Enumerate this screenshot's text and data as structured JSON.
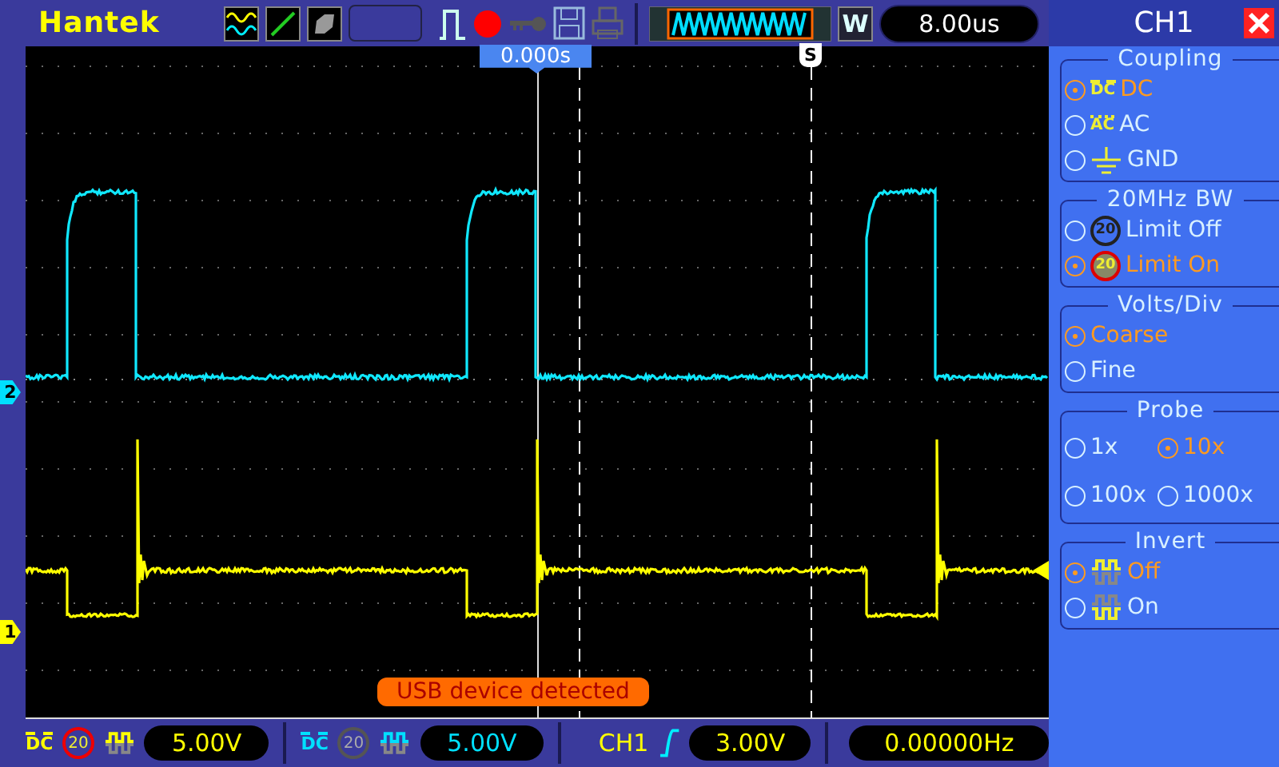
{
  "top_bar": {
    "logo": "Hantek",
    "timebase_mode": "W",
    "timebase": "8.00us"
  },
  "screen": {
    "time_position": "0.000s",
    "trigger_marker": "S",
    "message": "USB device detected",
    "markers": [
      {
        "label": "2",
        "color": "#00e0ff",
        "kind": "ch2"
      },
      {
        "label": "1",
        "color": "#ffff00",
        "kind": "ch1"
      }
    ]
  },
  "panel": {
    "title": "CH1",
    "groups": [
      {
        "title": "Coupling",
        "kind": "list",
        "options": [
          {
            "label": "DC",
            "kind": "dc",
            "icon_text": "DC",
            "selected": true
          },
          {
            "label": "AC",
            "kind": "ac",
            "icon_text": "AC",
            "selected": false
          },
          {
            "label": "GND",
            "kind": "gnd",
            "selected": false
          }
        ]
      },
      {
        "title": "20MHz BW",
        "kind": "list",
        "options": [
          {
            "label": "Limit Off",
            "kind": "bw_off",
            "icon_text": "20",
            "selected": false
          },
          {
            "label": "Limit On",
            "kind": "bw_on",
            "icon_text": "20",
            "selected": true
          }
        ]
      },
      {
        "title": "Volts/Div",
        "kind": "list",
        "options": [
          {
            "label": "Coarse",
            "kind": "plain",
            "selected": true
          },
          {
            "label": "Fine",
            "kind": "plain",
            "selected": false
          }
        ]
      },
      {
        "title": "Probe",
        "kind": "grid",
        "options": [
          {
            "label": "1x",
            "kind": "plain",
            "selected": false
          },
          {
            "label": "10x",
            "kind": "plain",
            "selected": true
          },
          {
            "label": "100x",
            "kind": "plain",
            "selected": false
          },
          {
            "label": "1000x",
            "kind": "plain",
            "selected": false
          }
        ]
      },
      {
        "title": "Invert",
        "kind": "list",
        "options": [
          {
            "label": "Off",
            "kind": "inv_off",
            "selected": true
          },
          {
            "label": "On",
            "kind": "inv_on",
            "selected": false
          }
        ]
      }
    ]
  },
  "status_bar": {
    "channels": [
      {
        "kind": "ch1",
        "coupling": "DC",
        "bw": "20",
        "bw_limit": true,
        "scale": "5.00V"
      },
      {
        "kind": "ch2",
        "coupling": "DC",
        "bw": "20",
        "bw_limit": false,
        "scale": "5.00V"
      }
    ],
    "trigger": {
      "source": "CH1",
      "level": "3.00V"
    },
    "frequency": "0.00000Hz"
  }
}
